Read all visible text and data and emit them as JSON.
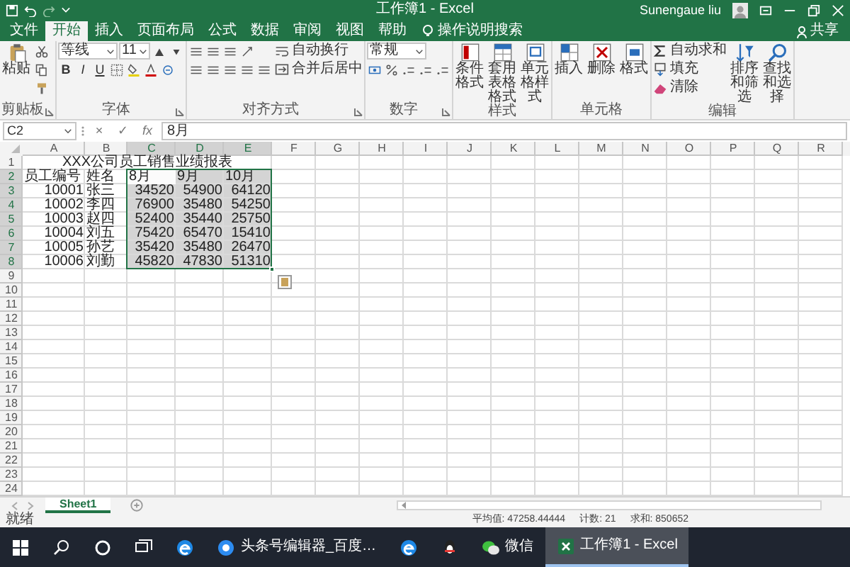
{
  "title_bar": {
    "title": "工作簿1 - Excel",
    "user": "Sunengaue liu"
  },
  "menu_tabs": [
    {
      "label": "文件",
      "selected": false
    },
    {
      "label": "开始",
      "selected": true
    },
    {
      "label": "插入",
      "selected": false
    },
    {
      "label": "页面布局",
      "selected": false
    },
    {
      "label": "公式",
      "selected": false
    },
    {
      "label": "数据",
      "selected": false
    },
    {
      "label": "审阅",
      "selected": false
    },
    {
      "label": "视图",
      "selected": false
    },
    {
      "label": "帮助",
      "selected": false
    }
  ],
  "tell_me": "操作说明搜索",
  "share": "共享",
  "ribbon": {
    "groups": [
      {
        "label": "剪贴板",
        "launcher": true,
        "columns": [
          [
            [
              {
                "kind": "big",
                "label": "粘贴"
              }
            ]
          ],
          [
            [
              {
                "kind": "icon"
              }
            ],
            [
              {
                "kind": "icon"
              }
            ],
            [
              {
                "kind": "icon"
              }
            ]
          ]
        ]
      },
      {
        "label": "字体",
        "launcher": true,
        "columns": [
          [
            [
              {
                "kind": "combo",
                "value": "等线"
              },
              {
                "kind": "sizecombo",
                "value": "11"
              },
              {
                "kind": "icon"
              },
              {
                "kind": "icon"
              }
            ],
            [
              {
                "kind": "glyph",
                "text": "B"
              },
              {
                "kind": "glyph",
                "text": "I"
              },
              {
                "kind": "glyph",
                "text": "U"
              },
              {
                "kind": "icon"
              },
              {
                "kind": "icon"
              },
              {
                "kind": "icon"
              },
              {
                "kind": "icon"
              }
            ]
          ]
        ]
      },
      {
        "label": "对齐方式",
        "launcher": true,
        "columns": [
          [
            [
              {
                "kind": "icon"
              },
              {
                "kind": "icon"
              },
              {
                "kind": "icon"
              },
              {
                "kind": "icon"
              }
            ],
            [
              {
                "kind": "icon"
              },
              {
                "kind": "icon"
              },
              {
                "kind": "icon"
              },
              {
                "kind": "icon"
              },
              {
                "kind": "icon"
              }
            ]
          ],
          [
            [
              {
                "kind": "small",
                "label": "自动换行"
              }
            ],
            [
              {
                "kind": "small",
                "label": "合并后居中"
              }
            ]
          ]
        ]
      },
      {
        "label": "数字",
        "launcher": true,
        "columns": [
          [
            [
              {
                "kind": "combo",
                "value": "常规"
              }
            ],
            [
              {
                "kind": "icon"
              },
              {
                "kind": "icon"
              },
              {
                "kind": "icon"
              },
              {
                "kind": "icon"
              },
              {
                "kind": "icon"
              }
            ]
          ]
        ]
      },
      {
        "label": "样式",
        "launcher": false,
        "columns": [
          [
            [
              {
                "kind": "big",
                "label": "条件格式"
              }
            ]
          ],
          [
            [
              {
                "kind": "big",
                "label": "套用表格格式"
              }
            ]
          ],
          [
            [
              {
                "kind": "big",
                "label": "单元格样式"
              }
            ]
          ]
        ]
      },
      {
        "label": "单元格",
        "launcher": false,
        "columns": [
          [
            [
              {
                "kind": "big",
                "label": "插入"
              }
            ]
          ],
          [
            [
              {
                "kind": "big",
                "label": "删除"
              }
            ]
          ],
          [
            [
              {
                "kind": "big",
                "label": "格式"
              }
            ]
          ]
        ]
      },
      {
        "label": "编辑",
        "launcher": false,
        "columns": [
          [
            [
              {
                "kind": "small",
                "label": "自动求和"
              }
            ],
            [
              {
                "kind": "small",
                "label": "填充"
              }
            ],
            [
              {
                "kind": "small",
                "label": "清除"
              }
            ]
          ],
          [
            [
              {
                "kind": "big",
                "label": "排序和筛选"
              }
            ]
          ],
          [
            [
              {
                "kind": "big",
                "label": "查找和选择"
              }
            ]
          ]
        ]
      }
    ]
  },
  "formula_bar": {
    "name_box": "C2",
    "buttons": [
      "×",
      "✓",
      "fx"
    ],
    "formula": "8月"
  },
  "sheet": {
    "columns": [
      {
        "label": "A",
        "selected": false
      },
      {
        "label": "B",
        "selected": false
      },
      {
        "label": "C",
        "selected": true
      },
      {
        "label": "D",
        "selected": true
      },
      {
        "label": "E",
        "selected": true
      },
      {
        "label": "F",
        "selected": false
      },
      {
        "label": "G",
        "selected": false
      },
      {
        "label": "H",
        "selected": false
      },
      {
        "label": "I",
        "selected": false
      },
      {
        "label": "J",
        "selected": false
      },
      {
        "label": "K",
        "selected": false
      },
      {
        "label": "L",
        "selected": false
      },
      {
        "label": "M",
        "selected": false
      },
      {
        "label": "N",
        "selected": false
      },
      {
        "label": "O",
        "selected": false
      },
      {
        "label": "P",
        "selected": false
      },
      {
        "label": "Q",
        "selected": false
      },
      {
        "label": "R",
        "selected": false
      }
    ],
    "rows": [
      {
        "number": "1",
        "selected": false,
        "cells": [
          {
            "kind": "merged",
            "text": "XXX公司员工销售业绩报表",
            "selected": false,
            "active": false
          }
        ]
      },
      {
        "number": "2",
        "selected": true,
        "cells": [
          {
            "kind": "text",
            "text": "员工编号",
            "selected": false,
            "active": false
          },
          {
            "kind": "text",
            "text": "姓名",
            "selected": false,
            "active": false
          },
          {
            "kind": "text",
            "text": "8月",
            "selected": true,
            "active": true
          },
          {
            "kind": "text",
            "text": "9月",
            "selected": true,
            "active": false
          },
          {
            "kind": "text",
            "text": "10月",
            "selected": true,
            "active": false
          }
        ]
      },
      {
        "number": "3",
        "selected": true,
        "cells": [
          {
            "kind": "number",
            "text": "10001",
            "selected": false,
            "active": false
          },
          {
            "kind": "text",
            "text": "张三",
            "selected": false,
            "active": false
          },
          {
            "kind": "number",
            "text": "34520",
            "selected": true,
            "active": false
          },
          {
            "kind": "number",
            "text": "54900",
            "selected": true,
            "active": false
          },
          {
            "kind": "number",
            "text": "64120",
            "selected": true,
            "active": false
          }
        ]
      },
      {
        "number": "4",
        "selected": true,
        "cells": [
          {
            "kind": "number",
            "text": "10002",
            "selected": false,
            "active": false
          },
          {
            "kind": "text",
            "text": "李四",
            "selected": false,
            "active": false
          },
          {
            "kind": "number",
            "text": "76900",
            "selected": true,
            "active": false
          },
          {
            "kind": "number",
            "text": "35480",
            "selected": true,
            "active": false
          },
          {
            "kind": "number",
            "text": "54250",
            "selected": true,
            "active": false
          }
        ]
      },
      {
        "number": "5",
        "selected": true,
        "cells": [
          {
            "kind": "number",
            "text": "10003",
            "selected": false,
            "active": false
          },
          {
            "kind": "text",
            "text": "赵四",
            "selected": false,
            "active": false
          },
          {
            "kind": "number",
            "text": "52400",
            "selected": true,
            "active": false
          },
          {
            "kind": "number",
            "text": "35440",
            "selected": true,
            "active": false
          },
          {
            "kind": "number",
            "text": "25750",
            "selected": true,
            "active": false
          }
        ]
      },
      {
        "number": "6",
        "selected": true,
        "cells": [
          {
            "kind": "number",
            "text": "10004",
            "selected": false,
            "active": false
          },
          {
            "kind": "text",
            "text": "刘五",
            "selected": false,
            "active": false
          },
          {
            "kind": "number",
            "text": "75420",
            "selected": true,
            "active": false
          },
          {
            "kind": "number",
            "text": "65470",
            "selected": true,
            "active": false
          },
          {
            "kind": "number",
            "text": "15410",
            "selected": true,
            "active": false
          }
        ]
      },
      {
        "number": "7",
        "selected": true,
        "cells": [
          {
            "kind": "number",
            "text": "10005",
            "selected": false,
            "active": false
          },
          {
            "kind": "text",
            "text": "孙艺",
            "selected": false,
            "active": false
          },
          {
            "kind": "number",
            "text": "35420",
            "selected": true,
            "active": false
          },
          {
            "kind": "number",
            "text": "35480",
            "selected": true,
            "active": false
          },
          {
            "kind": "number",
            "text": "26470",
            "selected": true,
            "active": false
          }
        ]
      },
      {
        "number": "8",
        "selected": true,
        "cells": [
          {
            "kind": "number",
            "text": "10006",
            "selected": false,
            "active": false
          },
          {
            "kind": "text",
            "text": "刘勤",
            "selected": false,
            "active": false
          },
          {
            "kind": "number",
            "text": "45820",
            "selected": true,
            "active": false
          },
          {
            "kind": "number",
            "text": "47830",
            "selected": true,
            "active": false
          },
          {
            "kind": "number",
            "text": "51310",
            "selected": true,
            "active": false
          }
        ]
      },
      {
        "number": "9",
        "selected": false
      },
      {
        "number": "10",
        "selected": false
      },
      {
        "number": "11",
        "selected": false
      },
      {
        "number": "12",
        "selected": false
      },
      {
        "number": "13",
        "selected": false
      },
      {
        "number": "14",
        "selected": false
      },
      {
        "number": "15",
        "selected": false
      },
      {
        "number": "16",
        "selected": false
      },
      {
        "number": "17",
        "selected": false
      },
      {
        "number": "18",
        "selected": false
      },
      {
        "number": "19",
        "selected": false
      },
      {
        "number": "20",
        "selected": false
      },
      {
        "number": "21",
        "selected": false
      },
      {
        "number": "22",
        "selected": false
      },
      {
        "number": "23",
        "selected": false
      },
      {
        "number": "24",
        "selected": false
      }
    ]
  },
  "sheet_tabs": [
    {
      "label": "Sheet1",
      "selected": true
    }
  ],
  "status_bar": {
    "state": "就绪",
    "stats": [
      "平均值: 47258.44444",
      "计数: 21",
      "求和: 850652"
    ]
  },
  "taskbar": [
    {
      "kind": "start",
      "selected": false
    },
    {
      "kind": "search",
      "selected": false
    },
    {
      "kind": "cortana",
      "selected": false
    },
    {
      "kind": "taskview",
      "selected": false
    },
    {
      "kind": "edge",
      "selected": false
    },
    {
      "kind": "browser",
      "label": "头条号编辑器_百度…",
      "selected": false
    },
    {
      "kind": "edge",
      "selected": false
    },
    {
      "kind": "qq",
      "selected": false
    },
    {
      "kind": "wechat",
      "label": "微信",
      "selected": false
    },
    {
      "kind": "excel",
      "label": "工作簿1 - Excel",
      "selected": true
    }
  ]
}
